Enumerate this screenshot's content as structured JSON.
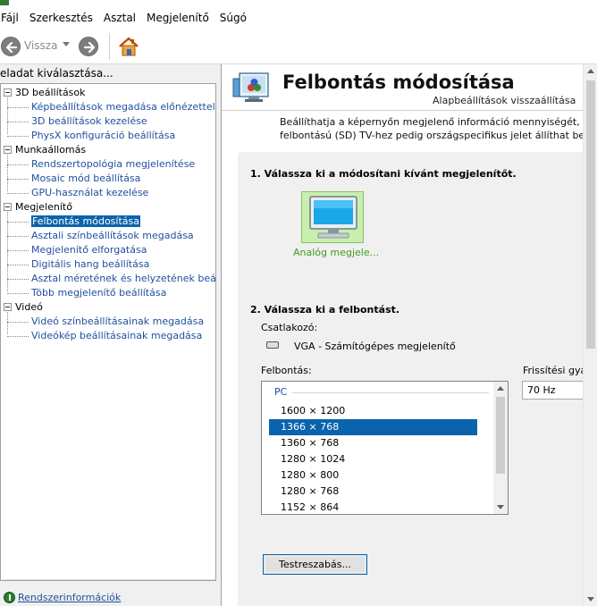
{
  "menubar": {
    "items": [
      "Fájl",
      "Szerkesztés",
      "Asztal",
      "Megjelenítő",
      "Súgó"
    ]
  },
  "toolbar": {
    "back_label": "Vissza"
  },
  "left": {
    "task_label": "eladat kiválasztása...",
    "categories": [
      {
        "label": "3D beállítások",
        "children": [
          "Képbeállítások megadása előnézettel",
          "3D beállítások kezelése",
          "PhysX konfiguráció beállítása"
        ]
      },
      {
        "label": "Munkaállomás",
        "children": [
          "Rendszertopológia megjelenítése",
          "Mosaic mód beállítása",
          "GPU-használat kezelése"
        ]
      },
      {
        "label": "Megjelenítő",
        "children": [
          "Felbontás módosítása",
          "Asztali színbeállítások megadása",
          "Megjelenítő elforgatása",
          "Digitális hang beállítása",
          "Asztal méretének és helyzetének beállítása",
          "Több megjelenítő beállítása"
        ]
      },
      {
        "label": "Videó",
        "children": [
          "Videó színbeállításainak megadása",
          "Videókép beállításainak megadása"
        ]
      }
    ],
    "selected": "Felbontás módosítása",
    "system_info": "Rendszerinformációk"
  },
  "right": {
    "title": "Felbontás módosítása",
    "restore_link": "Alapbeállítások visszaállítása",
    "description_line1": "Beállíthatja a képernyőn megjelenő információ mennyiségét, és csökkent",
    "description_line2": "felbontású (SD) TV-hez pedig országspecifikus jelet állíthat be.",
    "section1": "1. Válassza ki a módosítani kívánt megjelenítőt.",
    "display_label": "Analóg megjele...",
    "section2": "2. Válassza ki a felbontást.",
    "connector_label": "Csatlakozó:",
    "connector_value": "VGA - Számítógépes megjelenítő",
    "resolution_label": "Felbontás:",
    "refresh_label": "Frissítési gyako",
    "resolution_group": "PC",
    "resolutions": [
      "1600 × 1200",
      "1366 × 768",
      "1360 × 768",
      "1280 × 1024",
      "1280 × 800",
      "1280 × 768",
      "1152 × 864"
    ],
    "selected_resolution": "1366 × 768",
    "refresh_value": "70 Hz",
    "custom_button": "Testreszabás..."
  }
}
